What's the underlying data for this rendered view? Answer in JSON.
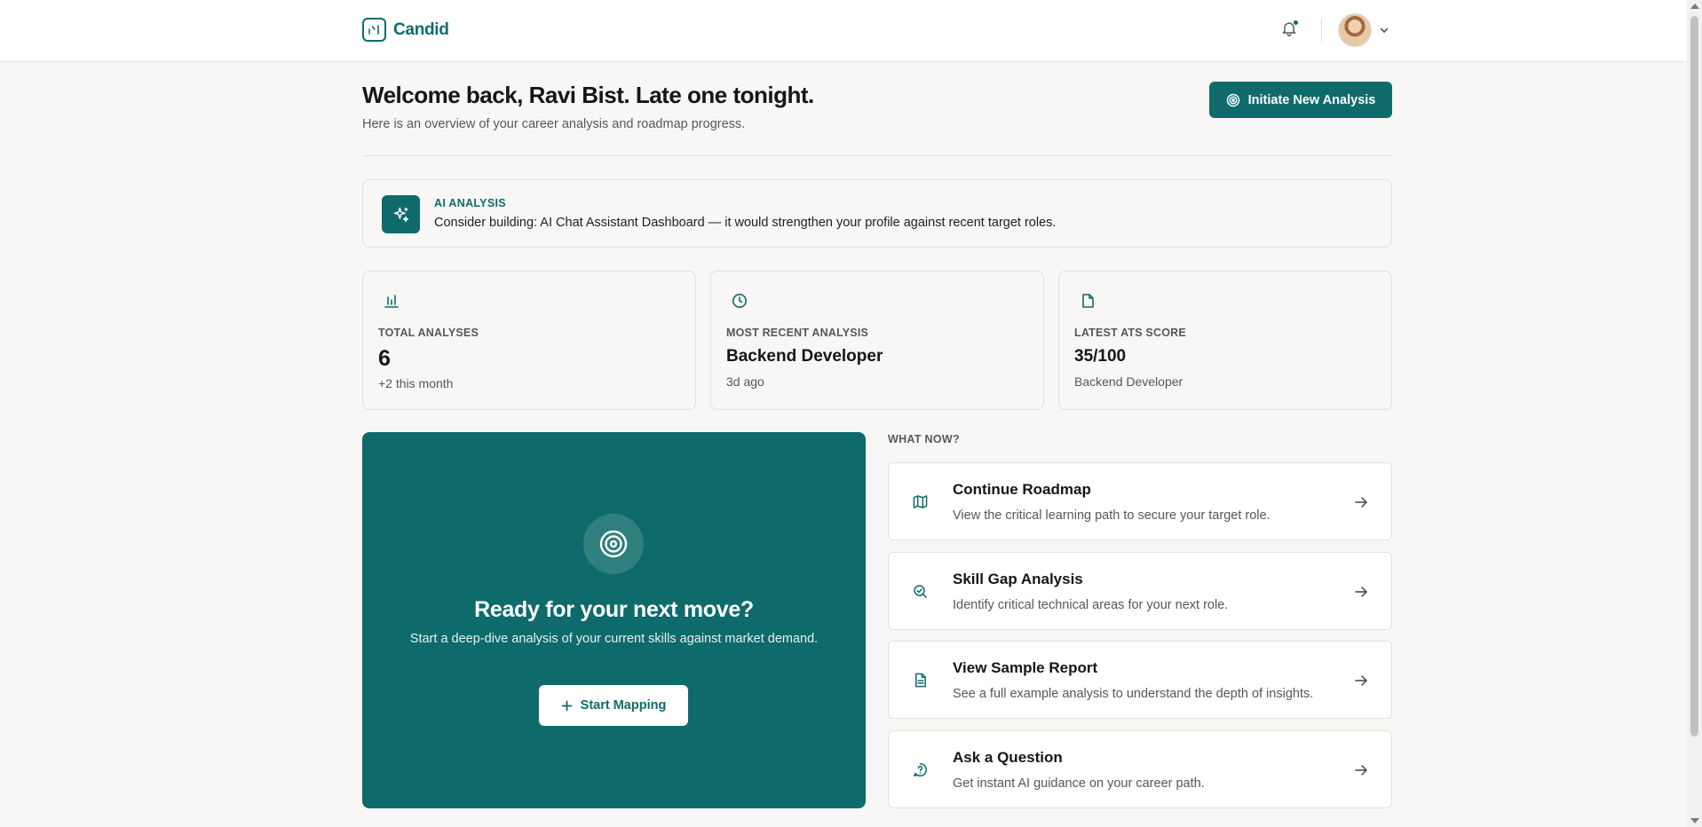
{
  "brand": {
    "name": "Candid"
  },
  "header": {
    "title": "Welcome back, Ravi Bist. Late one tonight.",
    "subtitle": "Here is an overview of your career analysis and roadmap progress.",
    "primary_button": "Initiate New Analysis"
  },
  "ai_analysis": {
    "label": "AI ANALYSIS",
    "text": "Consider building: AI Chat Assistant Dashboard — it would strengthen your profile against recent target roles."
  },
  "stats": [
    {
      "icon": "bar-chart-icon",
      "label": "TOTAL ANALYSES",
      "value": "6",
      "sub": "+2 this month"
    },
    {
      "icon": "clock-icon",
      "label": "MOST RECENT ANALYSIS",
      "value": "Backend Developer",
      "sub": "3d ago"
    },
    {
      "icon": "file-icon",
      "label": "LATEST ATS SCORE",
      "value": "35/100",
      "sub": "Backend Developer"
    }
  ],
  "hero": {
    "title": "Ready for your next move?",
    "subtitle": "Start a deep-dive analysis of your current skills against market demand.",
    "button": "Start Mapping"
  },
  "what_now": {
    "label": "WHAT NOW?",
    "items": [
      {
        "icon": "map-icon",
        "title": "Continue Roadmap",
        "desc": "View the critical learning path to secure your target role."
      },
      {
        "icon": "search-icon",
        "title": "Skill Gap Analysis",
        "desc": "Identify critical technical areas for your next role."
      },
      {
        "icon": "document-icon",
        "title": "View Sample Report",
        "desc": "See a full example analysis to understand the depth of insights."
      },
      {
        "icon": "question-icon",
        "title": "Ask a Question",
        "desc": "Get instant AI guidance on your career path."
      }
    ]
  },
  "colors": {
    "accent": "#0f6b6b",
    "background": "#f8f7f5",
    "text": "#161616",
    "muted": "#55575a"
  }
}
